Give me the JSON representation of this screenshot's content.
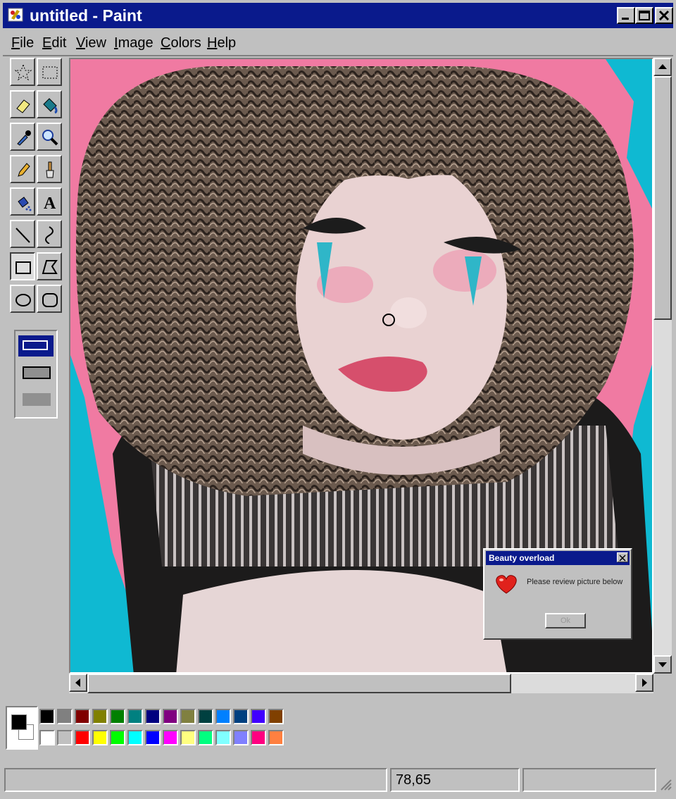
{
  "window": {
    "title": "untitled - Paint",
    "app_icon": "paint-app-icon"
  },
  "title_buttons": {
    "minimize_icon": "minimize-icon",
    "maximize_icon": "maximize-icon",
    "close_icon": "close-icon"
  },
  "menu": {
    "items": [
      {
        "label": "File",
        "key": "F"
      },
      {
        "label": "Edit",
        "key": "E"
      },
      {
        "label": "View",
        "key": "V"
      },
      {
        "label": "Image",
        "key": "I"
      },
      {
        "label": "Colors",
        "key": "C"
      },
      {
        "label": "Help",
        "key": "H"
      }
    ]
  },
  "tools": [
    {
      "name": "free-form-select",
      "icon": "star-select-icon"
    },
    {
      "name": "select",
      "icon": "rectangle-select-icon"
    },
    {
      "name": "eraser",
      "icon": "eraser-icon"
    },
    {
      "name": "fill",
      "icon": "paint-bucket-icon"
    },
    {
      "name": "pick-color",
      "icon": "eyedropper-icon"
    },
    {
      "name": "magnifier",
      "icon": "magnifier-icon"
    },
    {
      "name": "pencil",
      "icon": "pencil-icon"
    },
    {
      "name": "brush",
      "icon": "brush-icon"
    },
    {
      "name": "airbrush",
      "icon": "airbrush-icon"
    },
    {
      "name": "text",
      "icon": "text-icon"
    },
    {
      "name": "line",
      "icon": "line-icon"
    },
    {
      "name": "curve",
      "icon": "curve-icon"
    },
    {
      "name": "rectangle",
      "icon": "rectangle-icon",
      "selected": true
    },
    {
      "name": "polygon",
      "icon": "polygon-icon"
    },
    {
      "name": "ellipse",
      "icon": "ellipse-icon"
    },
    {
      "name": "rounded-rectangle",
      "icon": "rounded-rectangle-icon"
    }
  ],
  "tool_options": {
    "selected_index": 0,
    "options": [
      "outline",
      "outline-fill",
      "fill-only"
    ]
  },
  "palette": {
    "foreground": "#000000",
    "background": "#ffffff",
    "top_row": [
      "#000000",
      "#808080",
      "#800000",
      "#808000",
      "#008000",
      "#008080",
      "#000080",
      "#800080",
      "#808040",
      "#004040",
      "#0080ff",
      "#004080",
      "#4000ff",
      "#804000"
    ],
    "bottom_row": [
      "#ffffff",
      "#c0c0c0",
      "#ff0000",
      "#ffff00",
      "#00ff00",
      "#00ffff",
      "#0000ff",
      "#ff00ff",
      "#ffff80",
      "#00ff80",
      "#80ffff",
      "#8080ff",
      "#ff0080",
      "#ff8040"
    ]
  },
  "status": {
    "message": "",
    "coordinates": "78,65",
    "size": ""
  },
  "dialog": {
    "title": "Beauty overload",
    "message": "Please review picture below",
    "ok_label": "Ok",
    "icon": "heart-icon"
  },
  "canvas": {
    "image": "photo-portrait-curly-hair",
    "colors": {
      "pink": "#f07aa2",
      "cyan": "#0fb9d2",
      "hair": "#6b5a4e",
      "skin": "#e9d2d2",
      "top": "#2a2a2a"
    }
  }
}
